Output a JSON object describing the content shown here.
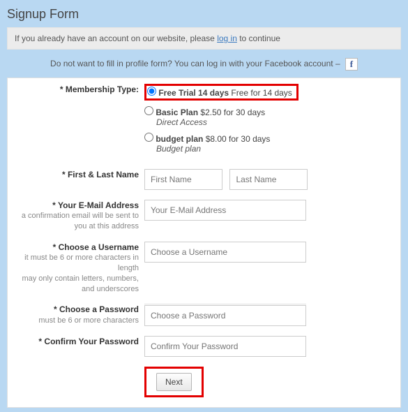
{
  "title": "Signup Form",
  "notice": {
    "prefix": "If you already have an account on our website, please ",
    "link": "log in",
    "suffix": " to continue"
  },
  "fb": {
    "text": "Do not want to fill in profile form? You can log in with your Facebook account – ",
    "icon": "f"
  },
  "membership": {
    "label": "Membership Type:",
    "options": [
      {
        "title": "Free Trial 14 days",
        "price": "Free for 14 days",
        "desc": "",
        "selected": true,
        "highlight": true
      },
      {
        "title": "Basic Plan",
        "price": "$2.50 for 30 days",
        "desc": "Direct Access",
        "selected": false,
        "highlight": false
      },
      {
        "title": "budget plan",
        "price": "$8.00 for 30 days",
        "desc": "Budget plan",
        "selected": false,
        "highlight": false
      }
    ]
  },
  "name": {
    "label": "First & Last Name",
    "first_ph": "First Name",
    "last_ph": "Last Name"
  },
  "email": {
    "label": "Your E-Mail Address",
    "hint": "a confirmation email will be sent to you at this address",
    "ph": "Your E-Mail Address"
  },
  "username": {
    "label": "Choose a Username",
    "hint1": "it must be 6 or more characters in length",
    "hint2": "may only contain letters, numbers, and underscores",
    "ph": "Choose a Username"
  },
  "password": {
    "label": "Choose a Password",
    "hint": "must be 6 or more characters",
    "ph": "Choose a Password"
  },
  "confirm": {
    "label": "Confirm Your Password",
    "ph": "Confirm Your Password"
  },
  "next": "Next",
  "star": "* "
}
